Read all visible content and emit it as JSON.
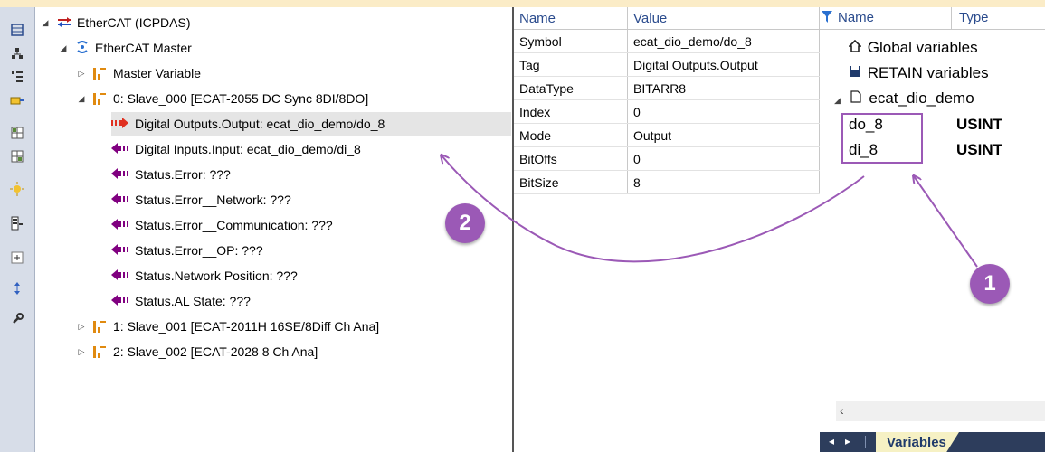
{
  "tree": {
    "root": "EtherCAT (ICPDAS)",
    "master": "EtherCAT Master",
    "master_variable": "Master Variable",
    "slave0": "0: Slave_000 [ECAT-2055 DC Sync 8DI/8DO]",
    "items": [
      "Digital Outputs.Output: ecat_dio_demo/do_8",
      "Digital Inputs.Input: ecat_dio_demo/di_8",
      "Status.Error: ???",
      "Status.Error__Network: ???",
      "Status.Error__Communication: ???",
      "Status.Error__OP: ???",
      "Status.Network Position: ???",
      "Status.AL State: ???"
    ],
    "slave1": "1: Slave_001 [ECAT-2011H 16SE/8Diff Ch Ana]",
    "slave2": "2: Slave_002 [ECAT-2028 8 Ch Ana]"
  },
  "props": {
    "header_name": "Name",
    "header_value": "Value",
    "rows": [
      {
        "name": "Symbol",
        "value": "ecat_dio_demo/do_8"
      },
      {
        "name": "Tag",
        "value": "Digital Outputs.Output"
      },
      {
        "name": "DataType",
        "value": "BITARR8"
      },
      {
        "name": "Index",
        "value": "0"
      },
      {
        "name": "Mode",
        "value": "Output"
      },
      {
        "name": "BitOffs",
        "value": "0"
      },
      {
        "name": "BitSize",
        "value": "8"
      }
    ]
  },
  "vars": {
    "header_name": "Name",
    "header_type": "Type",
    "global": "Global variables",
    "retain": "RETAIN variables",
    "program": "ecat_dio_demo",
    "rows": [
      {
        "name": "do_8",
        "type": "USINT"
      },
      {
        "name": "di_8",
        "type": "USINT"
      }
    ],
    "tab_label": "Variables"
  },
  "badges": [
    "1",
    "2"
  ],
  "colors": {
    "accent": "#9b59b6",
    "header_text": "#2a4b8d",
    "tab_bar": "#2d3d5c"
  }
}
